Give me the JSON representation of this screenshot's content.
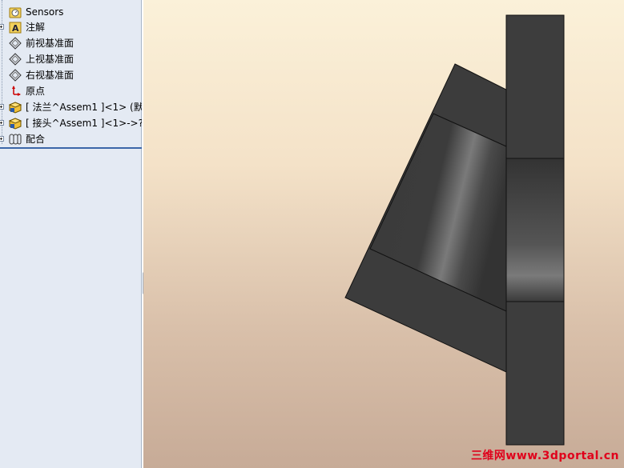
{
  "tree": {
    "items": [
      {
        "label": "Sensors",
        "icon": "sensors-icon"
      },
      {
        "label": "注解",
        "icon": "annotation-icon"
      },
      {
        "label": "前视基准面",
        "icon": "plane-icon"
      },
      {
        "label": "上视基准面",
        "icon": "plane-icon"
      },
      {
        "label": "右视基准面",
        "icon": "plane-icon"
      },
      {
        "label": "原点",
        "icon": "origin-icon"
      },
      {
        "label": "[ 法兰^Assem1 ]<1> (默认",
        "icon": "part-icon"
      },
      {
        "label": "[ 接头^Assem1 ]<1>->?",
        "icon": "part-icon"
      },
      {
        "label": "配合",
        "icon": "mates-icon"
      }
    ]
  },
  "watermark": "三维网www.3dportal.cn",
  "colors": {
    "panel_bg": "#e4eaf3",
    "model_dark": "#3a3a3a",
    "watermark": "#e0001b"
  }
}
